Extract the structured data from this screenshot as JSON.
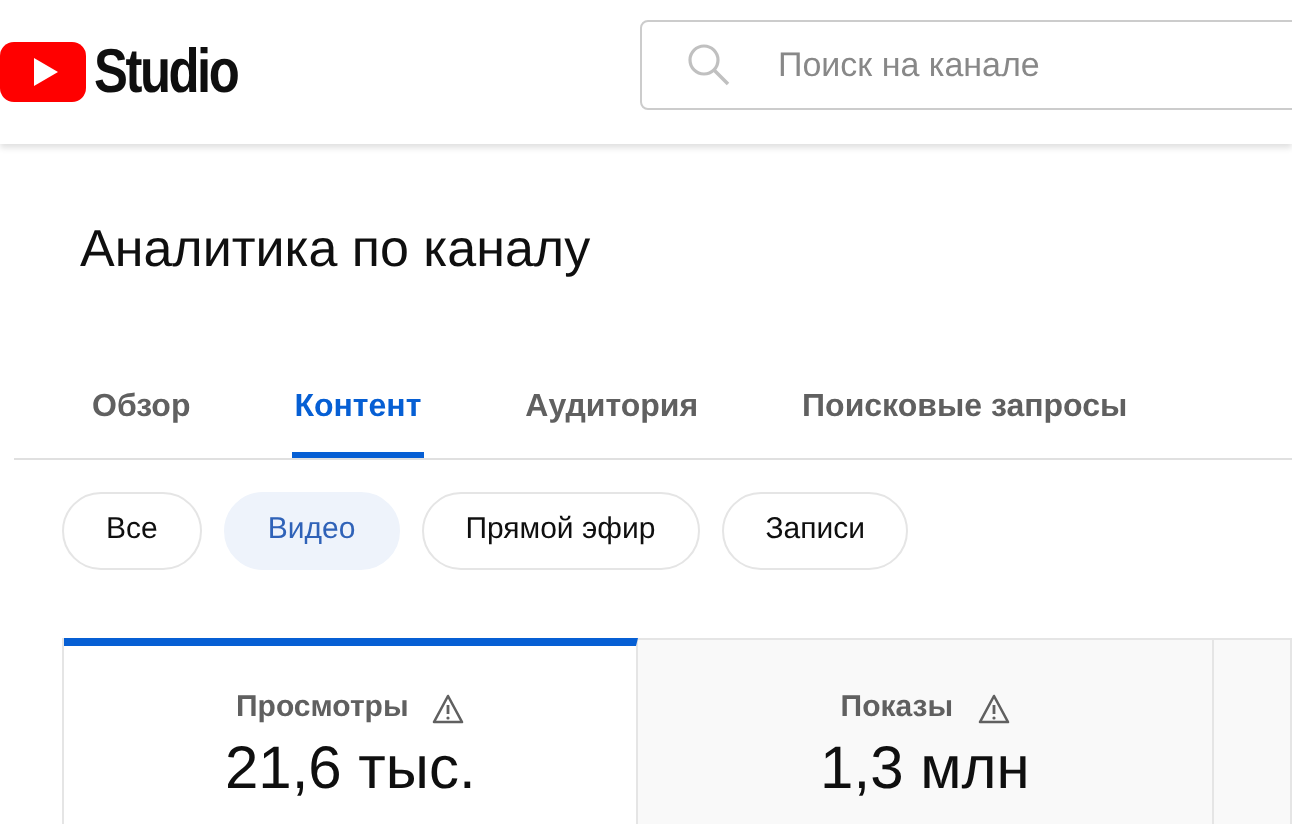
{
  "header": {
    "logo_text": "Studio",
    "search": {
      "placeholder": "Поиск на канале"
    }
  },
  "title": "Аналитика по каналу",
  "tabs": [
    {
      "label": "Обзор",
      "selected": false
    },
    {
      "label": "Контент",
      "selected": true
    },
    {
      "label": "Аудитория",
      "selected": false
    },
    {
      "label": "Поисковые запросы",
      "selected": false
    }
  ],
  "chips": [
    {
      "label": "Все",
      "selected": false
    },
    {
      "label": "Видео",
      "selected": true
    },
    {
      "label": "Прямой эфир",
      "selected": false
    },
    {
      "label": "Записи",
      "selected": false
    }
  ],
  "metrics": [
    {
      "label": "Просмотры",
      "value": "21,6 тыс.",
      "selected": true
    },
    {
      "label": "Показы",
      "value": "1,3 млн",
      "selected": false
    }
  ]
}
